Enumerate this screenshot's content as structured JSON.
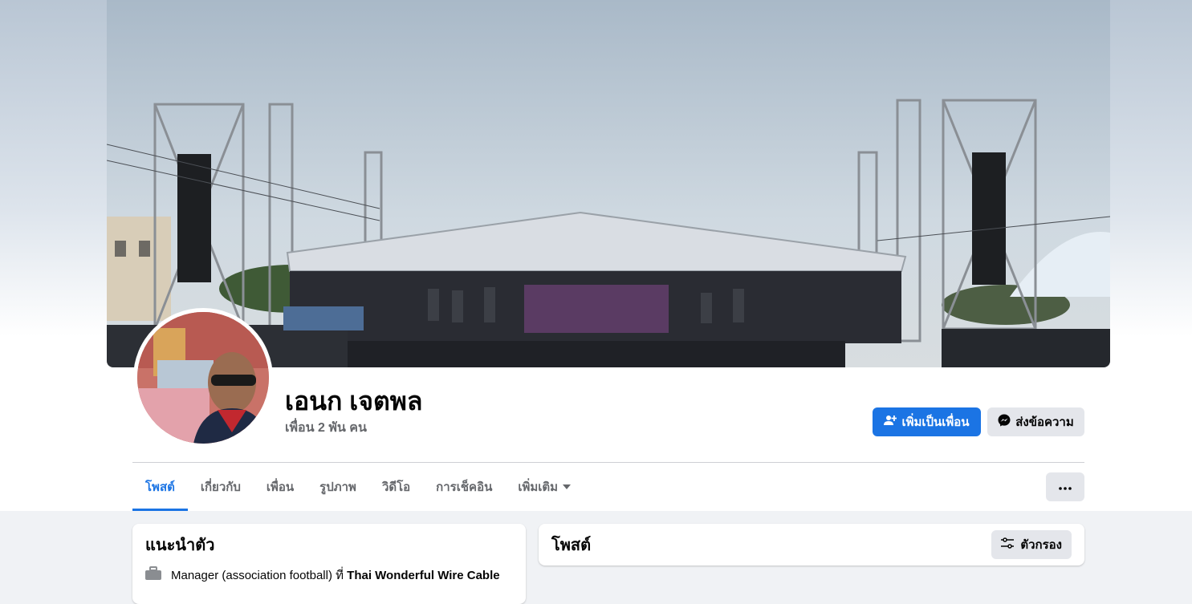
{
  "profile": {
    "name": "เอนก เจตพล",
    "friends_count": "เพื่อน 2 พัน คน"
  },
  "actions": {
    "add_friend": "เพิ่มเป็นเพื่อน",
    "message": "ส่งข้อความ"
  },
  "tabs": [
    {
      "label": "โพสต์",
      "active": true
    },
    {
      "label": "เกี่ยวกับ"
    },
    {
      "label": "เพื่อน"
    },
    {
      "label": "รูปภาพ"
    },
    {
      "label": "วิดีโอ"
    },
    {
      "label": "การเช็คอิน"
    },
    {
      "label": "เพิ่มเติม"
    }
  ],
  "intro": {
    "title": "แนะนำตัว",
    "work_prefix": "Manager (association football) ที่ ",
    "work_company": "Thai Wonderful Wire Cable"
  },
  "posts": {
    "title": "โพสต์",
    "filter_label": "ตัวกรอง"
  },
  "colors": {
    "accent": "#1b74e4",
    "secondary_button": "#e4e6eb",
    "muted_text": "#65676b"
  },
  "icons": [
    "add-friend-icon",
    "messenger-icon",
    "caret-down-icon",
    "more-dots-icon",
    "briefcase-icon",
    "filter-sliders-icon"
  ]
}
